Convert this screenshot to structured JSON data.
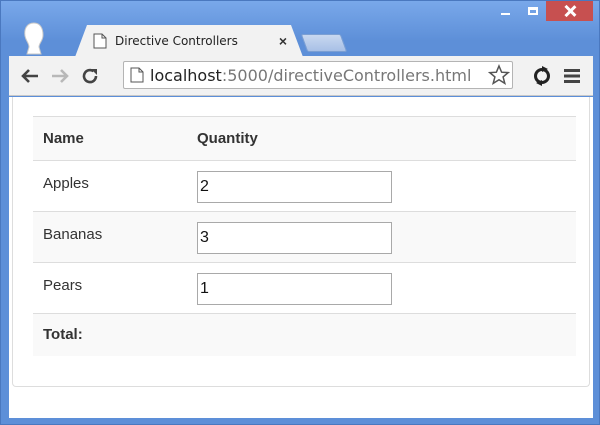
{
  "window": {
    "caption": {
      "minimize_icon": "minimize-icon",
      "maximize_icon": "maximize-icon",
      "close_icon": "close-icon",
      "close_color": "#c75050"
    }
  },
  "tab": {
    "title": "Directive Controllers",
    "close_glyph": "×"
  },
  "toolbar": {
    "url_host": "localhost",
    "url_rest": ":5000/directiveControllers.html"
  },
  "table": {
    "headers": {
      "name": "Name",
      "quantity": "Quantity"
    },
    "rows": [
      {
        "name": "Apples",
        "quantity": "2"
      },
      {
        "name": "Bananas",
        "quantity": "3"
      },
      {
        "name": "Pears",
        "quantity": "1"
      }
    ],
    "footer": {
      "label": "Total:"
    }
  }
}
